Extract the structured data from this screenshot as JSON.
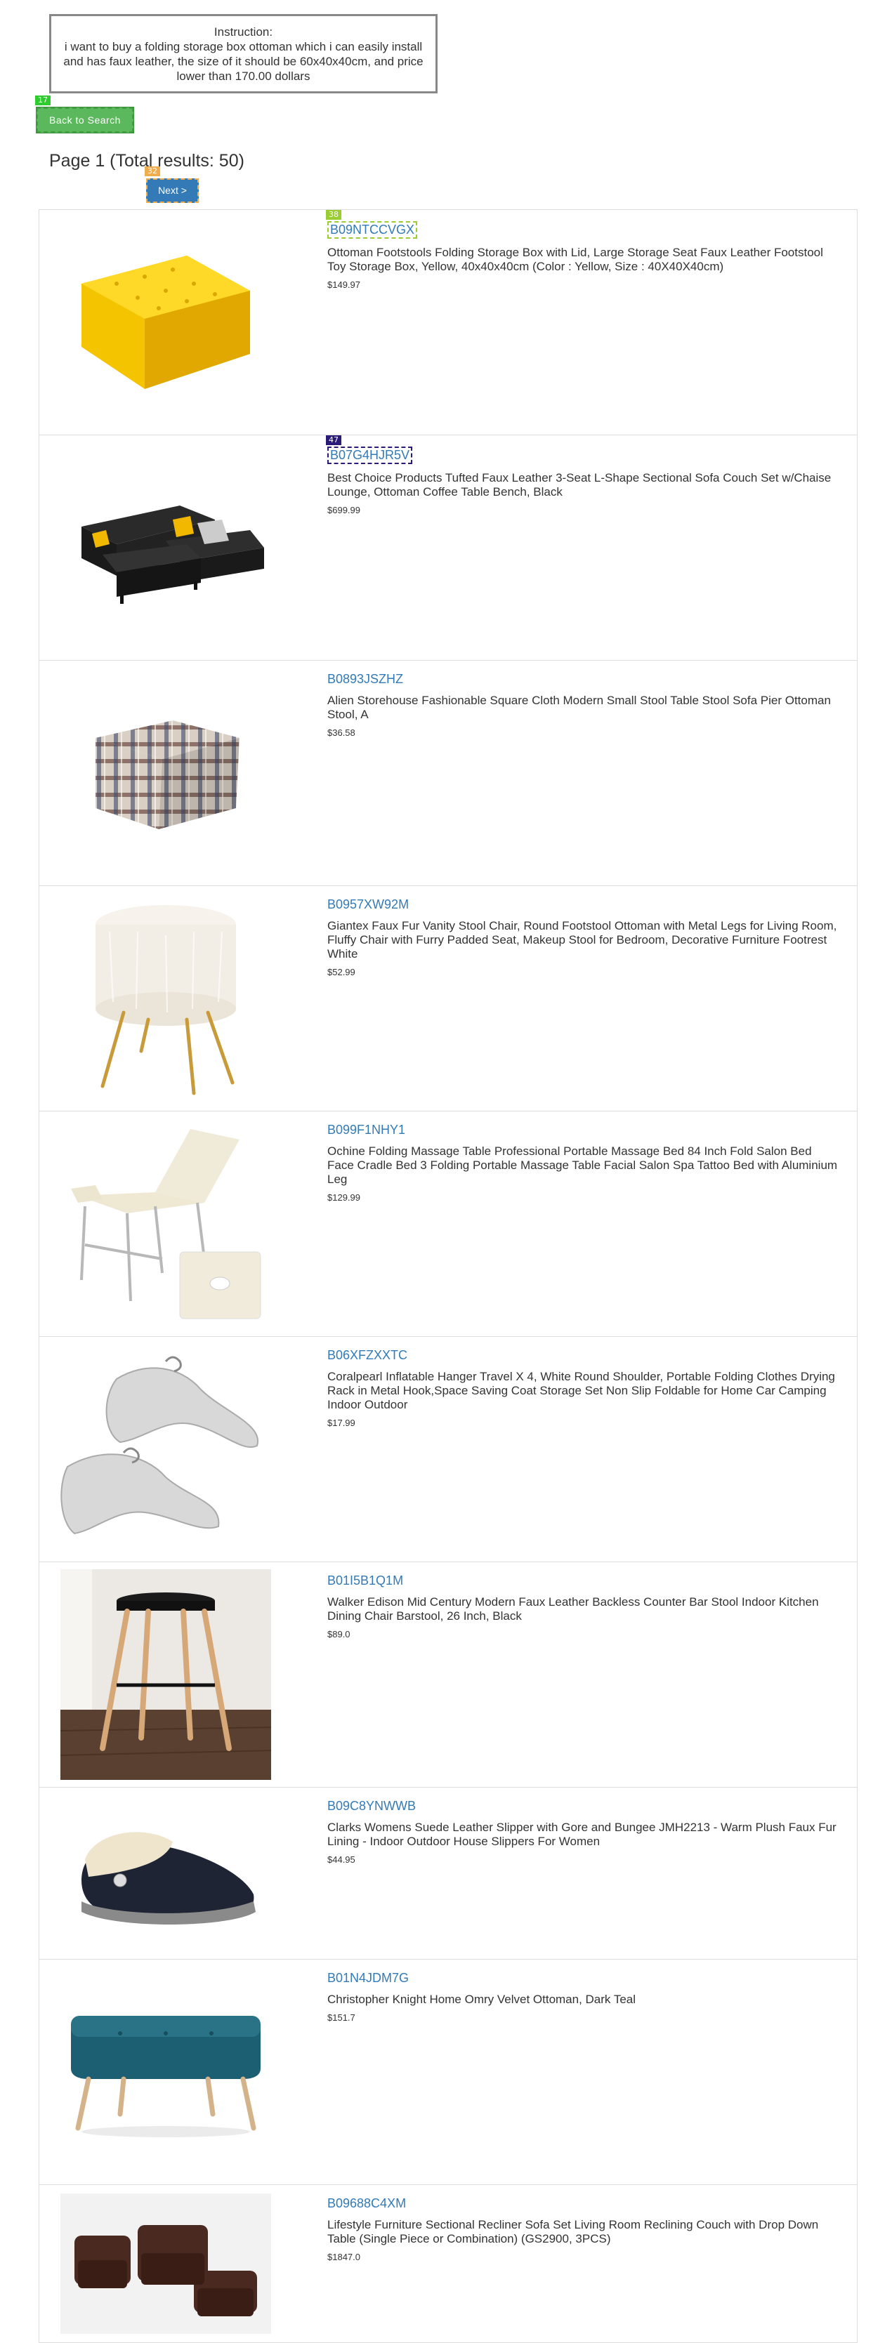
{
  "instruction": {
    "heading": "Instruction:",
    "text": "i want to buy a folding storage box ottoman which i can easily install and has faux leather, the size of it should be 60x40x40cm, and price lower than 170.00 dollars"
  },
  "nav": {
    "back_label": "Back to Search",
    "back_badge": "17",
    "page_info": "Page 1 (Total results: 50)",
    "next_label": "Next >",
    "next_badge": "32"
  },
  "colors": {
    "link": "#337ab7",
    "back_button": "#5cb85c",
    "next_button": "#337ab7",
    "badge_green": "#2ecc2e",
    "badge_orange": "#f0ad4e",
    "badge_lightgreen": "#9acd32",
    "badge_purple": "#2a1a7a"
  },
  "products": [
    {
      "asin": "B09NTCCVGX",
      "badge": "38",
      "title": "Ottoman Footstools Folding Storage Box with Lid, Large Storage Seat Faux Leather Footstool Toy Storage Box, Yellow, 40x40x40cm (Color : Yellow, Size : 40X40X40cm)",
      "price": "$149.97",
      "image": "yellow-ottoman"
    },
    {
      "asin": "B07G4HJR5V",
      "badge": "47",
      "title": "Best Choice Products Tufted Faux Leather 3-Seat L-Shape Sectional Sofa Couch Set w/Chaise Lounge, Ottoman Coffee Table Bench, Black",
      "price": "$699.99",
      "image": "black-sofa"
    },
    {
      "asin": "B0893JSZHZ",
      "title": "Alien Storehouse Fashionable Square Cloth Modern Small Stool Table Stool Sofa Pier Ottoman Stool, A",
      "price": "$36.58",
      "image": "plaid-stool"
    },
    {
      "asin": "B0957XW92M",
      "title": "Giantex Faux Fur Vanity Stool Chair, Round Footstool Ottoman with Metal Legs for Living Room, Fluffy Chair with Furry Padded Seat, Makeup Stool for Bedroom, Decorative Furniture Footrest White",
      "price": "$52.99",
      "image": "fur-stool"
    },
    {
      "asin": "B099F1NHY1",
      "title": "Ochine Folding Massage Table Professional Portable Massage Bed 84 Inch Fold Salon Bed Face Cradle Bed 3 Folding Portable Massage Table Facial Salon Spa Tattoo Bed with Aluminium Leg",
      "price": "$129.99",
      "image": "massage-table"
    },
    {
      "asin": "B06XFZXXTC",
      "title": "Coralpearl Inflatable Hanger Travel X 4, White Round Shoulder, Portable Folding Clothes Drying Rack in Metal Hook,Space Saving Coat Storage Set Non Slip Foldable for Home Car Camping Indoor Outdoor",
      "price": "$17.99",
      "image": "inflatable-hangers"
    },
    {
      "asin": "B01I5B1Q1M",
      "title": "Walker Edison Mid Century Modern Faux Leather Backless Counter Bar Stool Indoor Kitchen Dining Chair Barstool, 26 Inch, Black",
      "price": "$89.0",
      "image": "bar-stool"
    },
    {
      "asin": "B09C8YNWWB",
      "title": "Clarks Womens Suede Leather Slipper with Gore and Bungee JMH2213 - Warm Plush Faux Fur Lining - Indoor Outdoor House Slippers For Women",
      "price": "$44.95",
      "image": "slipper"
    },
    {
      "asin": "B01N4JDM7G",
      "title": "Christopher Knight Home Omry Velvet Ottoman, Dark Teal",
      "price": "$151.7",
      "image": "teal-ottoman"
    },
    {
      "asin": "B09688C4XM",
      "title": "Lifestyle Furniture Sectional Recliner Sofa Set Living Room Reclining Couch with Drop Down Table (Single Piece or Combination) (GS2900, 3PCS)",
      "price": "$1847.0",
      "image": "recliner-set"
    }
  ]
}
